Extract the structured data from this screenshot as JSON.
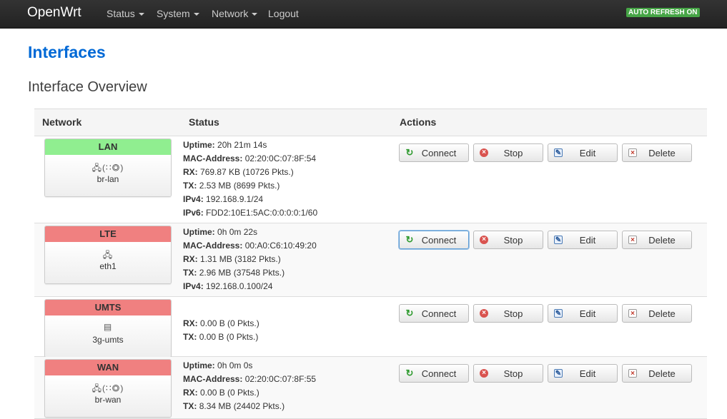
{
  "navbar": {
    "brand": "OpenWrt",
    "menu": [
      {
        "label": "Status",
        "has_dropdown": true
      },
      {
        "label": "System",
        "has_dropdown": true
      },
      {
        "label": "Network",
        "has_dropdown": true
      },
      {
        "label": "Logout",
        "has_dropdown": false
      }
    ],
    "auto_refresh": "AUTO REFRESH ON"
  },
  "page": {
    "title": "Interfaces",
    "section": "Interface Overview"
  },
  "table": {
    "headers": {
      "network": "Network",
      "status": "Status",
      "actions": "Actions"
    },
    "buttons": {
      "connect": "Connect",
      "stop": "Stop",
      "edit": "Edit",
      "delete": "Delete"
    },
    "status_colors": {
      "up": "#90ee90",
      "down": "#f08080"
    },
    "rows": [
      {
        "name": "LAN",
        "state": "up",
        "device": "br-lan",
        "icons": "bridge-ethernet-wireless-icons",
        "status": [
          {
            "k": "Uptime",
            "v": "20h 21m 14s"
          },
          {
            "k": "MAC-Address",
            "v": "02:20:0C:07:8F:54"
          },
          {
            "k": "RX",
            "v": "769.87 KB (10726 Pkts.)"
          },
          {
            "k": "TX",
            "v": "2.53 MB (8699 Pkts.)"
          },
          {
            "k": "IPv4",
            "v": "192.168.9.1/24"
          },
          {
            "k": "IPv6",
            "v": "FDD2:10E1:5AC:0:0:0:0:1/60"
          }
        ]
      },
      {
        "name": "LTE",
        "state": "down",
        "device": "eth1",
        "icons": "ethernet-icon",
        "status": [
          {
            "k": "Uptime",
            "v": "0h 0m 22s"
          },
          {
            "k": "MAC-Address",
            "v": "00:A0:C6:10:49:20"
          },
          {
            "k": "RX",
            "v": "1.31 MB (3182 Pkts.)"
          },
          {
            "k": "TX",
            "v": "2.96 MB (37548 Pkts.)"
          },
          {
            "k": "IPv4",
            "v": "192.168.0.100/24"
          }
        ]
      },
      {
        "name": "UMTS",
        "state": "down",
        "device": "3g-umts",
        "icons": "modem-icon",
        "status": [
          {
            "k": "RX",
            "v": "0.00 B (0 Pkts.)"
          },
          {
            "k": "TX",
            "v": "0.00 B (0 Pkts.)"
          }
        ]
      },
      {
        "name": "WAN",
        "state": "down",
        "device": "br-wan",
        "icons": "bridge-ethernet-wireless-icons",
        "status": [
          {
            "k": "Uptime",
            "v": "0h 0m 0s"
          },
          {
            "k": "MAC-Address",
            "v": "02:20:0C:07:8F:55"
          },
          {
            "k": "RX",
            "v": "0.00 B (0 Pkts.)"
          },
          {
            "k": "TX",
            "v": "8.34 MB (24402 Pkts.)"
          }
        ]
      }
    ]
  }
}
